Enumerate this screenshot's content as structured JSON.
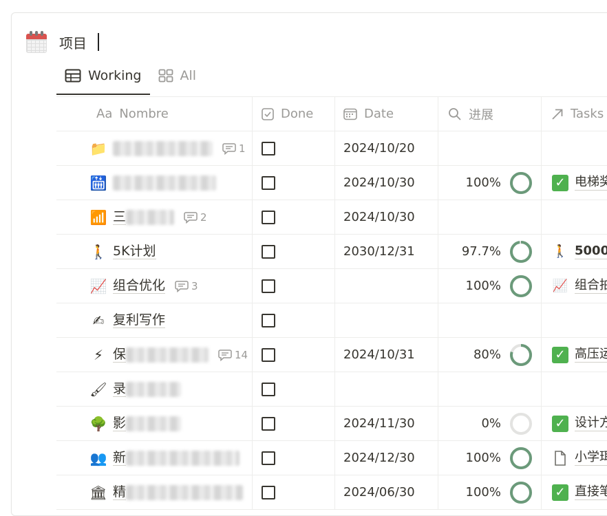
{
  "database": {
    "title": "项目",
    "icon": "calendar-icon"
  },
  "tabs": [
    {
      "label": "Working",
      "icon": "table-icon",
      "active": true
    },
    {
      "label": "All",
      "icon": "gallery-icon",
      "active": false
    }
  ],
  "columns": {
    "name": {
      "prefix": "Aa",
      "label": "Nombre"
    },
    "done": {
      "label": "Done",
      "icon": "checkbox-icon"
    },
    "date": {
      "label": "Date",
      "icon": "calendar-small-icon"
    },
    "progress": {
      "label": "进展",
      "icon": "search-icon"
    },
    "tasks": {
      "label": "Tasks",
      "icon": "relation-arrow-icon"
    }
  },
  "rows": [
    {
      "icon": "📁",
      "icon_name": "folder-icon",
      "name_visible": "",
      "comments": "1",
      "done": false,
      "date": "2024/10/20",
      "progress": "",
      "progress_value": null,
      "task_icon": "",
      "task_text": ""
    },
    {
      "icon": "🛗",
      "icon_name": "elevator-icon",
      "name_visible": "",
      "comments": "",
      "done": false,
      "date": "2024/10/30",
      "progress": "100%",
      "progress_value": 1.0,
      "task_icon": "✓",
      "task_text": "电梯奖"
    },
    {
      "icon": "📶",
      "icon_name": "signal-bars-icon",
      "name_visible": "三",
      "comments": "2",
      "done": false,
      "date": "2024/10/30",
      "progress": "",
      "progress_value": null,
      "task_icon": "",
      "task_text": ""
    },
    {
      "icon": "🚶",
      "icon_name": "walking-person-icon",
      "name_visible": "5K计划",
      "comments": "",
      "done": false,
      "date": "2030/12/31",
      "progress": "97.7%",
      "progress_value": 0.977,
      "task_icon": "🚶",
      "task_text": "5000"
    },
    {
      "icon": "📈",
      "icon_name": "chart-increasing-icon",
      "name_visible": "组合优化",
      "comments": "3",
      "done": false,
      "date": "",
      "progress": "100%",
      "progress_value": 1.0,
      "task_icon": "📈",
      "task_text": "组合拍"
    },
    {
      "icon": "✍",
      "icon_name": "writing-hand-icon",
      "name_visible": "复利写作",
      "comments": "",
      "done": false,
      "date": "",
      "progress": "",
      "progress_value": null,
      "task_icon": "",
      "task_text": ""
    },
    {
      "icon": "⚡",
      "icon_name": "lightning-icon",
      "name_visible": "保",
      "comments": "14",
      "done": false,
      "date": "2024/10/31",
      "progress": "80%",
      "progress_value": 0.8,
      "task_icon": "✓",
      "task_text": "高压运"
    },
    {
      "icon": "🖌",
      "icon_name": "paintbrush-icon",
      "name_visible": "录",
      "comments": "",
      "done": false,
      "date": "",
      "progress": "",
      "progress_value": null,
      "task_icon": "",
      "task_text": ""
    },
    {
      "icon": "🌳",
      "icon_name": "tree-icon",
      "name_visible": "影",
      "comments": "",
      "done": false,
      "date": "2024/11/30",
      "progress": "0%",
      "progress_value": 0.0,
      "task_icon": "✓",
      "task_text": "设计方"
    },
    {
      "icon": "👥",
      "icon_name": "people-icon",
      "name_visible": "新",
      "comments": "",
      "done": false,
      "date": "2024/12/30",
      "progress": "100%",
      "progress_value": 1.0,
      "task_icon": "doc",
      "task_text": "小学珥"
    },
    {
      "icon": "🏛",
      "icon_name": "classical-building-icon",
      "name_visible": "精",
      "comments": "",
      "done": false,
      "date": "2024/06/30",
      "progress": "100%",
      "progress_value": 1.0,
      "task_icon": "✓",
      "task_text": "直接笔"
    }
  ],
  "colors": {
    "progress_ring": "#6b9a7a",
    "progress_track": "#e3e3e1",
    "check_green": "#4fb14f"
  }
}
